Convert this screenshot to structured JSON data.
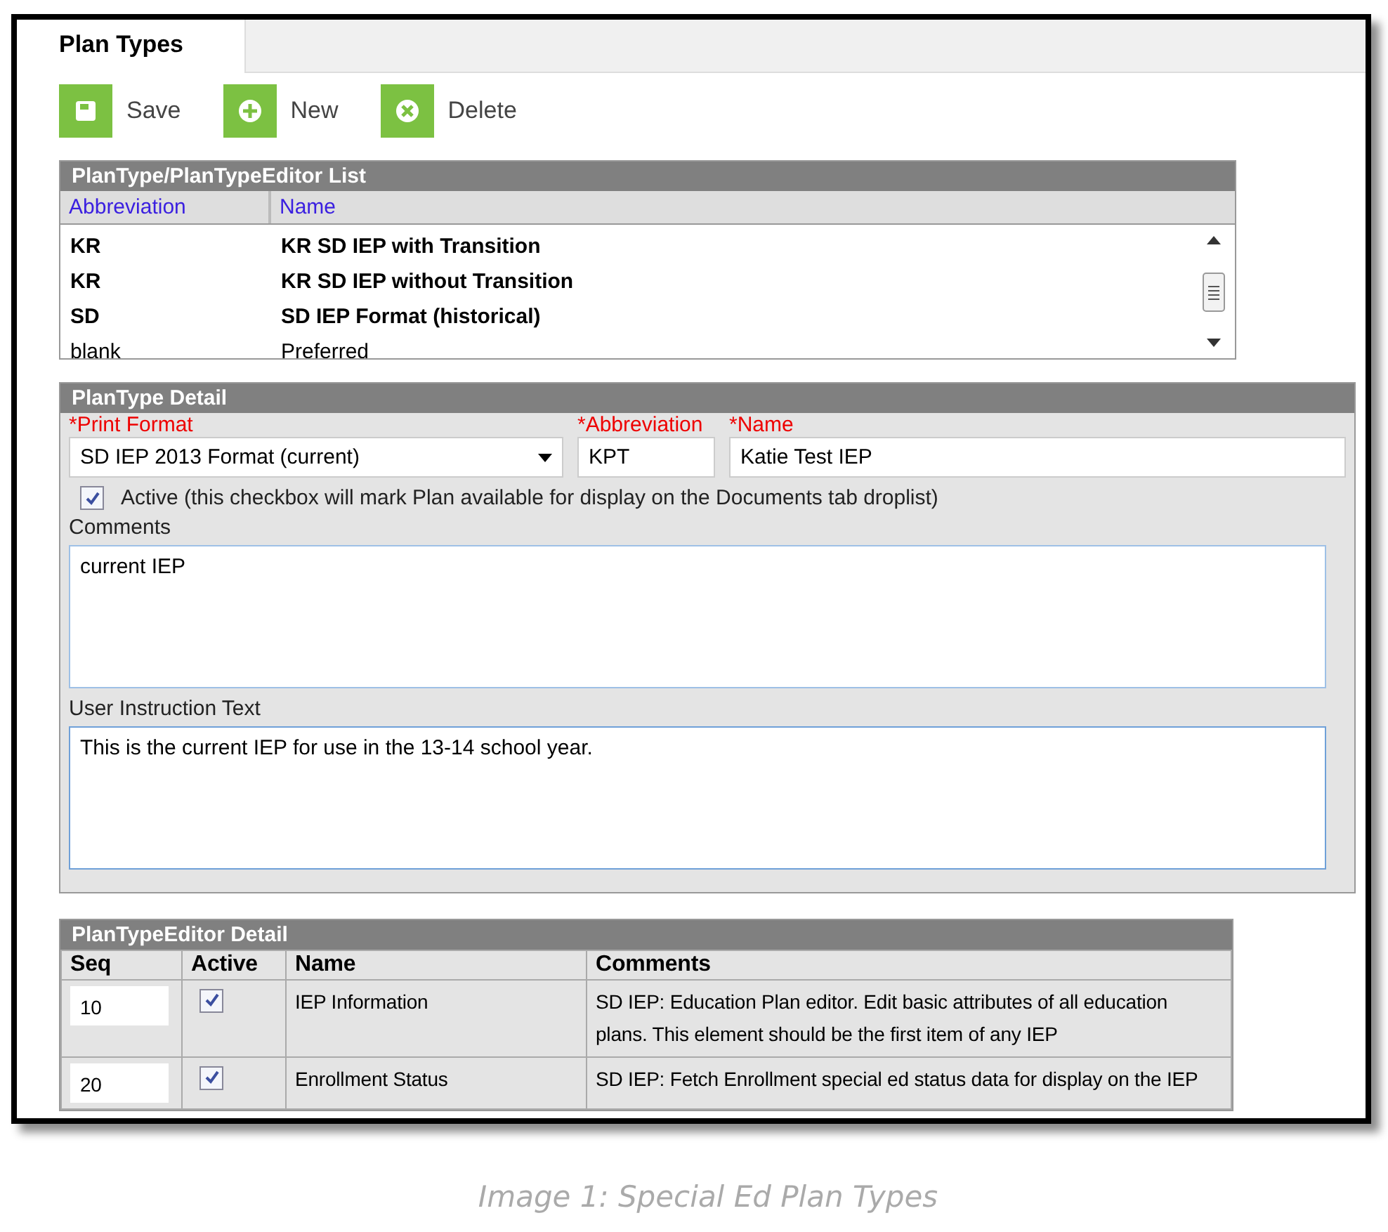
{
  "tabs": [
    {
      "label": "Plan Types",
      "selected": true
    }
  ],
  "toolbar": [
    {
      "kind": "save",
      "label": "Save"
    },
    {
      "kind": "new",
      "label": "New"
    },
    {
      "kind": "delete",
      "label": "Delete"
    }
  ],
  "plan_list": {
    "title": "PlanType/PlanTypeEditor List",
    "columns": [
      "Abbreviation",
      "Name"
    ],
    "rows": [
      {
        "abbreviation": "KR",
        "name": "KR SD IEP with Transition",
        "bold": true
      },
      {
        "abbreviation": "KR",
        "name": "KR SD IEP without Transition",
        "bold": true
      },
      {
        "abbreviation": "SD",
        "name": "SD IEP Format (historical)",
        "bold": true
      },
      {
        "abbreviation": "blank",
        "name": "Preferred",
        "bold": false
      }
    ]
  },
  "detail": {
    "title": "PlanType Detail",
    "print_format_label": "*Print Format",
    "print_format": "SD IEP 2013 Format (current)",
    "abbreviation_label": "*Abbreviation",
    "abbreviation": "KPT",
    "name_label": "*Name",
    "name": "Katie Test IEP",
    "active": {
      "checked": true,
      "label": "Active (this checkbox will mark Plan available for display on the Documents tab droplist)"
    },
    "comments_label": "Comments",
    "comments": "current IEP",
    "instruction_label": "User Instruction Text",
    "instruction": "This is the current IEP for use in the 13-14 school year."
  },
  "editor": {
    "title": "PlanTypeEditor Detail",
    "columns": [
      "Seq",
      "Active",
      "Name",
      "Comments"
    ],
    "rows": [
      {
        "seq": "10",
        "active": true,
        "name": "IEP Information",
        "comments": "SD IEP: Education Plan editor. Edit basic attributes of all education plans. This element should be the first item of any IEP"
      },
      {
        "seq": "20",
        "active": true,
        "name": "Enrollment Status",
        "comments": "SD IEP: Fetch Enrollment special ed status data for display on the IEP"
      }
    ]
  },
  "caption": "Image 1: Special Ed Plan Types"
}
